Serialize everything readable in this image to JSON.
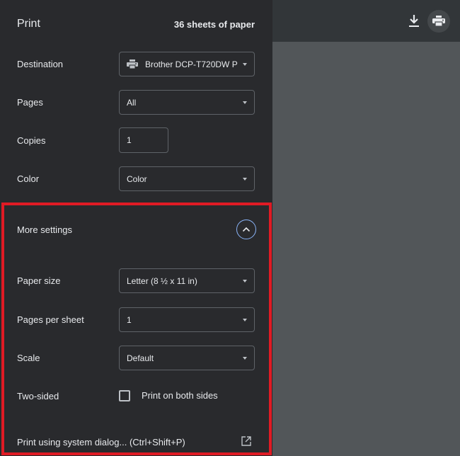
{
  "header": {
    "title": "Print",
    "sheets": "36 sheets of paper"
  },
  "destination": {
    "label": "Destination",
    "value": "Brother DCP-T720DW P",
    "icon": "printer-icon"
  },
  "pages": {
    "label": "Pages",
    "value": "All"
  },
  "copies": {
    "label": "Copies",
    "value": "1"
  },
  "color": {
    "label": "Color",
    "value": "Color"
  },
  "more_settings": {
    "label": "More settings",
    "icon": "chevron-up-icon"
  },
  "paper_size": {
    "label": "Paper size",
    "value": "Letter (8 ½ x 11 in)"
  },
  "pages_per_sheet": {
    "label": "Pages per sheet",
    "value": "1"
  },
  "scale": {
    "label": "Scale",
    "value": "Default"
  },
  "two_sided": {
    "label": "Two-sided",
    "checkbox_label": "Print on both sides",
    "checked": false
  },
  "system_dialog": {
    "label": "Print using system dialog... (Ctrl+Shift+P)",
    "icon": "open-in-new-icon"
  },
  "toolbar": {
    "download_icon": "download-icon",
    "print_icon": "printer-icon"
  },
  "colors": {
    "sidebar_bg": "#292a2d",
    "preview_bg": "#525659",
    "highlight": "#e01b24",
    "accent": "#8ab4f8"
  }
}
